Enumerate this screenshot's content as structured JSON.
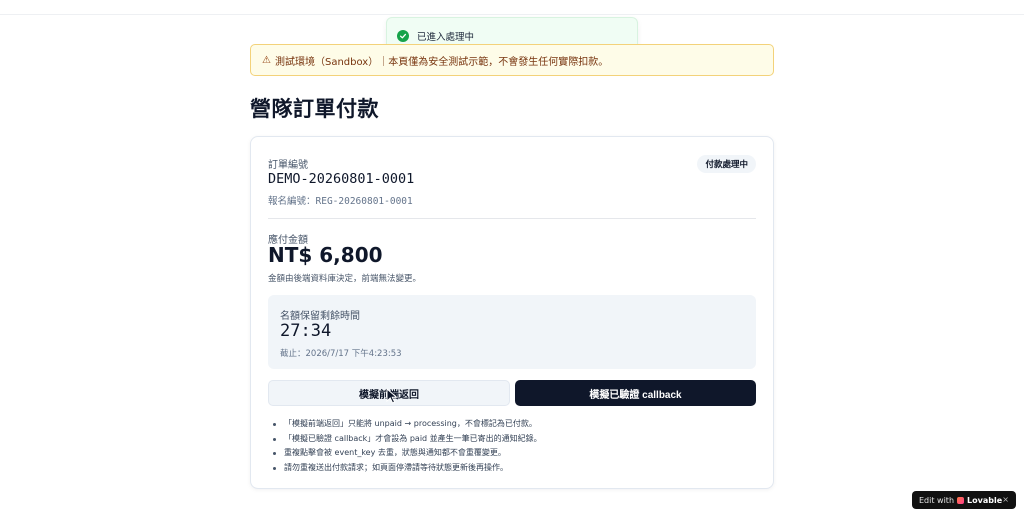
{
  "toast": {
    "message": "已進入處理中"
  },
  "banner": {
    "icon": "warning-icon",
    "text": "測試環境（Sandbox）｜本頁僅為安全測試示範，不會發生任何實際扣款。"
  },
  "page": {
    "title": "營隊訂單付款"
  },
  "order": {
    "number_label": "訂單編號",
    "number": "DEMO-20260801-0001",
    "registration_label": "報名編號：",
    "registration_number": "REG-20260801-0001",
    "status_badge": "付款處理中"
  },
  "amount": {
    "label": "應付金額",
    "value": "NT$ 6,800",
    "note": "金額由後端資料庫決定，前端無法變更。"
  },
  "timer": {
    "label": "名額保留剩餘時間",
    "remaining": "27:34",
    "deadline": "截止：2026/7/17 下午4:23:53"
  },
  "actions": {
    "simulate_return_label": "模擬前端返回",
    "simulate_callback_label": "模擬已驗證 callback"
  },
  "notes": [
    "「模擬前端返回」只能將 unpaid → processing，不會標記為已付款。",
    "「模擬已驗證 callback」才會設為 paid 並產生一筆已寄出的通知紀錄。",
    "重複點擊會被 event_key 去重，狀態與通知都不會重覆變更。",
    "請勿重複送出付款請求；如頁面停滯請等待狀態更新後再操作。"
  ],
  "lovable": {
    "prefix": "Edit with",
    "brand": "Lovable",
    "close": "×"
  },
  "colors": {
    "success": "#16a34a",
    "warning_bg": "#fefce8",
    "warning_border": "#f3d27a",
    "primary_dark": "#0f172a"
  }
}
